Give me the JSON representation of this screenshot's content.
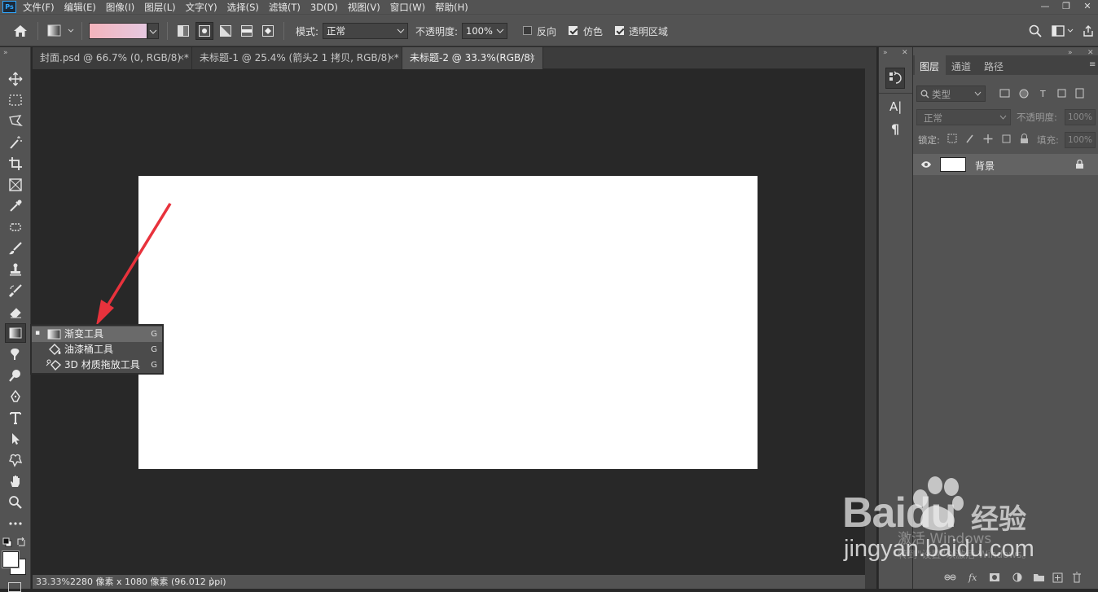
{
  "app": {
    "logo": "Ps"
  },
  "menubar": {
    "items": [
      "文件(F)",
      "编辑(E)",
      "图像(I)",
      "图层(L)",
      "文字(Y)",
      "选择(S)",
      "滤镜(T)",
      "3D(D)",
      "视图(V)",
      "窗口(W)",
      "帮助(H)"
    ],
    "window_controls": [
      "—",
      "❐",
      "✕"
    ]
  },
  "options": {
    "gradient_preview": [
      "#f4b4bc",
      "#e6c8e0"
    ],
    "mode_label": "模式:",
    "mode_value": "正常",
    "opacity_label": "不透明度:",
    "opacity_value": "100%",
    "reverse_label": "反向",
    "reverse_checked": false,
    "dither_label": "仿色",
    "dither_checked": true,
    "transparency_label": "透明区域",
    "transparency_checked": true
  },
  "tabs": [
    {
      "label": "封面.psd @ 66.7% (0, RGB/8) *",
      "close": "×"
    },
    {
      "label": "未标题-1 @ 25.4% (箭头2 1 拷贝, RGB/8) *",
      "close": "×"
    },
    {
      "label": "未标题-2 @ 33.3%(RGB/8)",
      "close": "×",
      "active": true
    }
  ],
  "flyout": {
    "items": [
      {
        "bullet": "▪",
        "label": "渐变工具",
        "key": "G",
        "selected": true
      },
      {
        "label": "油漆桶工具",
        "key": "G"
      },
      {
        "label": "3D 材质拖放工具",
        "key": "G"
      }
    ]
  },
  "status": {
    "zoom": "33.33%",
    "info": "2280 像素 x 1080 像素 (96.012 ppi)",
    "arrow": "〉"
  },
  "panel": {
    "tabs": [
      "图层",
      "通道",
      "路径"
    ],
    "filter_label": "类型",
    "blend_mode": "正常",
    "opacity_label": "不透明度:",
    "opacity_value": "100%",
    "lock_label": "锁定:",
    "fill_label": "填充:",
    "fill_value": "100%",
    "layers": [
      {
        "name": "背景",
        "visible": true,
        "locked": true
      }
    ]
  },
  "midpanel": {
    "char_label": "A|",
    "para_label": "¶"
  },
  "watermark": {
    "brand": "Baidu",
    "brand_cn": "经验",
    "url": "jingyan.baidu.com",
    "windows_line1": "激活 Windows",
    "windows_line2": "转到\"设置\"以激活 Windows。"
  },
  "colors": {
    "arrow": "#e8323c",
    "ui_bg": "#535353",
    "canvas_bg": "#282828"
  }
}
